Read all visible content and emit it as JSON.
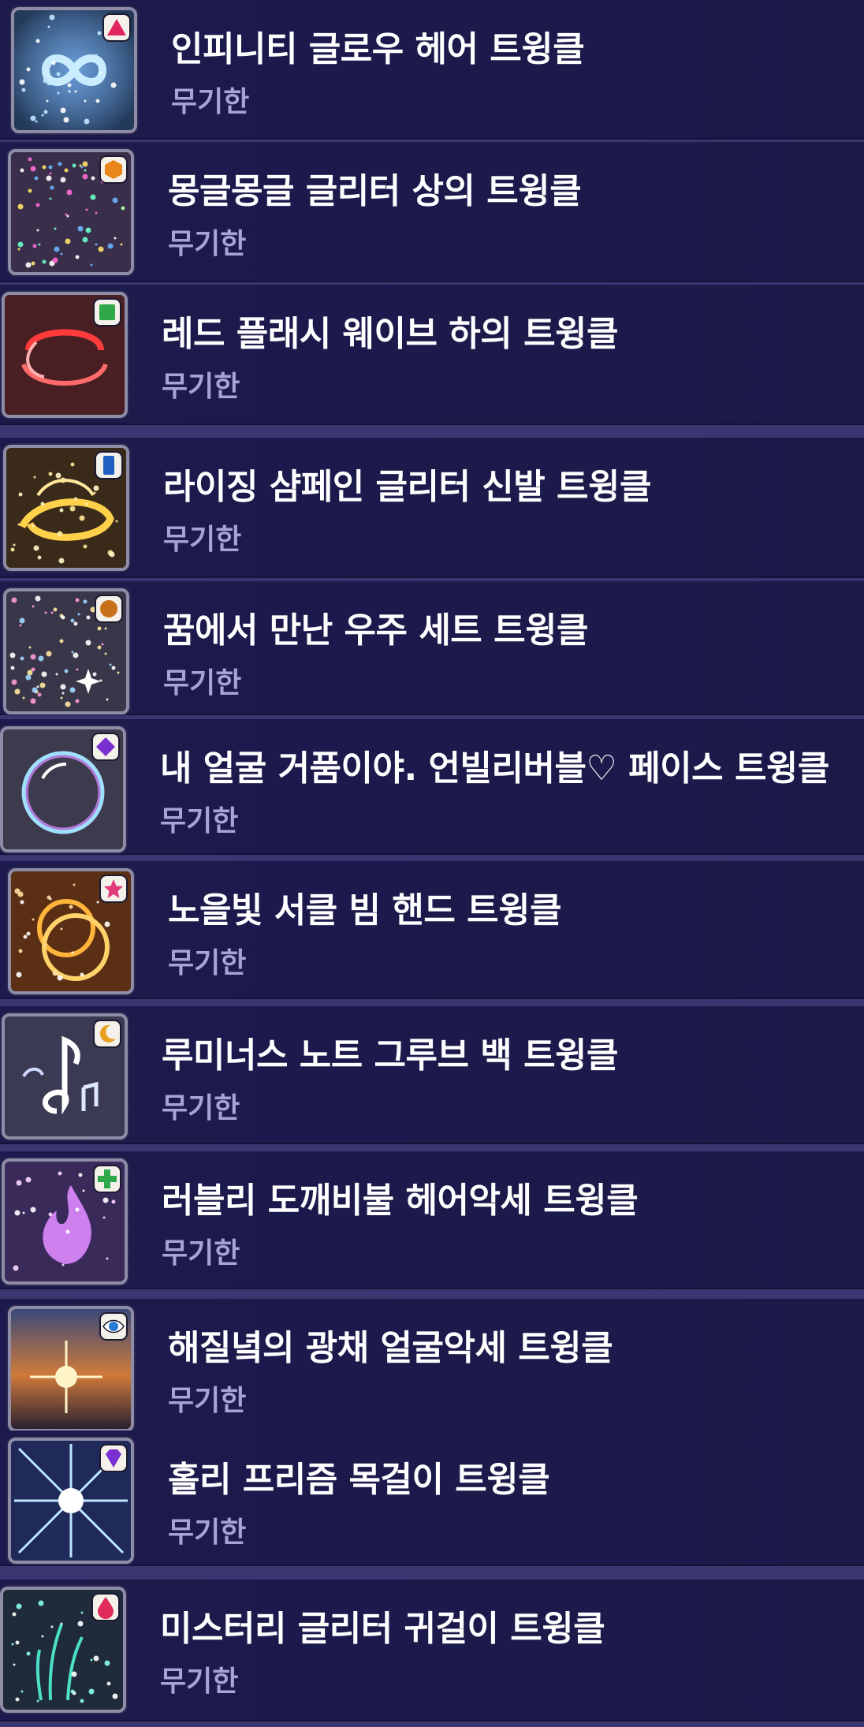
{
  "items": [
    {
      "name": "인피니티 글로우 헤어 트윙클",
      "duration": "무기한",
      "icon": "infinity-glow-icon",
      "badge": "triangle-gem-badge",
      "colors": {
        "bg": "#243a5a",
        "glow": "#c9ecff",
        "badge": "#e0245e"
      }
    },
    {
      "name": "몽글몽글 글리터 상의 트윙클",
      "duration": "무기한",
      "icon": "colorful-glitter-dots-icon",
      "badge": "hexagon-gem-badge",
      "colors": {
        "bg": "#3a2f4a",
        "glow": "#ffcf6a",
        "badge": "#e8861a"
      }
    },
    {
      "name": "레드 플래시 웨이브 하의 트윙클",
      "duration": "무기한",
      "icon": "red-flash-wave-icon",
      "badge": "green-square-gem-badge",
      "colors": {
        "bg": "#4a1f24",
        "glow": "#ff3b3b",
        "badge": "#2fa84a"
      }
    },
    {
      "name": "라이징 샴페인 글리터 신발 트윙클",
      "duration": "무기한",
      "icon": "champagne-swirl-icon",
      "badge": "blue-rectangle-gem-badge",
      "colors": {
        "bg": "#3a2a1a",
        "glow": "#ffd04a",
        "badge": "#1e5fbf"
      }
    },
    {
      "name": "꿈에서 만난 우주 세트 트윙클",
      "duration": "무기한",
      "icon": "cosmic-sparkles-icon",
      "badge": "amber-round-gem-badge",
      "colors": {
        "bg": "#3a364a",
        "glow": "#ffffff",
        "badge": "#c9701a"
      }
    },
    {
      "name": "내 얼굴 거품이야. 언빌리버블♡ 페이스 트윙클",
      "duration": "무기한",
      "icon": "bubble-icon",
      "badge": "purple-diamond-gem-badge",
      "colors": {
        "bg": "#3e3a4e",
        "glow": "#9ad8ff",
        "badge": "#7a2fd0"
      }
    },
    {
      "name": "노을빛 서클 빔 핸드 트윙클",
      "duration": "무기한",
      "icon": "sunset-circle-beam-icon",
      "badge": "pink-star-badge",
      "colors": {
        "bg": "#5a2f14",
        "glow": "#ffb43a",
        "badge": "#e03a7a"
      }
    },
    {
      "name": "루미너스 노트 그루브 백 트윙클",
      "duration": "무기한",
      "icon": "music-note-icon",
      "badge": "crescent-moon-badge",
      "colors": {
        "bg": "#3a3a52",
        "glow": "#ffffff",
        "badge": "#e8a020"
      }
    },
    {
      "name": "러블리 도깨비불 헤어악세 트윙클",
      "duration": "무기한",
      "icon": "pink-flame-icon",
      "badge": "green-clover-badge",
      "colors": {
        "bg": "#3a2a5a",
        "glow": "#e08aff",
        "badge": "#2ea84a"
      }
    },
    {
      "name": "해질녘의 광채 얼굴악세 트윙클",
      "duration": "무기한",
      "icon": "sunset-radiance-icon",
      "badge": "blue-eye-badge",
      "colors": {
        "bg": "#2a3050",
        "glow": "#ffd37a",
        "badge": "#2a7ad8"
      }
    },
    {
      "name": "홀리 프리즘 목걸이 트윙클",
      "duration": "무기한",
      "icon": "holy-prism-burst-icon",
      "badge": "purple-gem-badge",
      "colors": {
        "bg": "#1f2a5a",
        "glow": "#ffffff",
        "badge": "#7a2fd0"
      }
    },
    {
      "name": "미스터리 글리터 귀걸이 트윙클",
      "duration": "무기한",
      "icon": "teal-glitter-icon",
      "badge": "pink-drop-gem-badge",
      "colors": {
        "bg": "#1f2a3a",
        "glow": "#4ae0c8",
        "badge": "#e02a5a"
      }
    }
  ]
}
